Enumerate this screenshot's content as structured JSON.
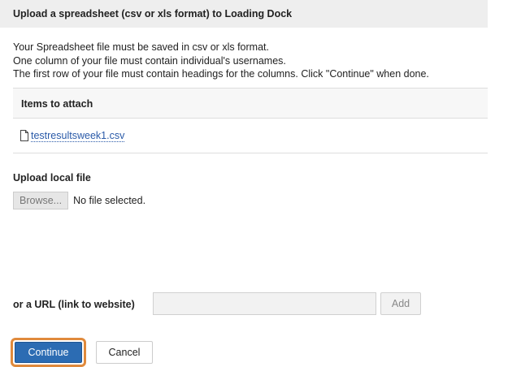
{
  "header": {
    "title": "Upload a spreadsheet (csv or xls format) to Loading Dock"
  },
  "instructions": {
    "line1": "Your Spreadsheet file must be saved in csv or xls format.",
    "line2": "One column of your file must contain individual's usernames.",
    "line3": "The first row of your file must contain headings for the columns. Click \"Continue\" when done."
  },
  "attachments": {
    "header": "Items to attach",
    "files": [
      {
        "name": "testresultsweek1.csv",
        "icon": "file-icon"
      }
    ]
  },
  "upload": {
    "label": "Upload local file",
    "browse_label": "Browse...",
    "status": "No file selected."
  },
  "url": {
    "label": "or a URL (link to website)",
    "value": "",
    "placeholder": "",
    "add_label": "Add"
  },
  "actions": {
    "continue_label": "Continue",
    "cancel_label": "Cancel"
  },
  "colors": {
    "primary": "#2c6cb3",
    "focus_ring": "#e08a3c",
    "link": "#2a5aa8",
    "header_bg": "#eeeeee"
  }
}
